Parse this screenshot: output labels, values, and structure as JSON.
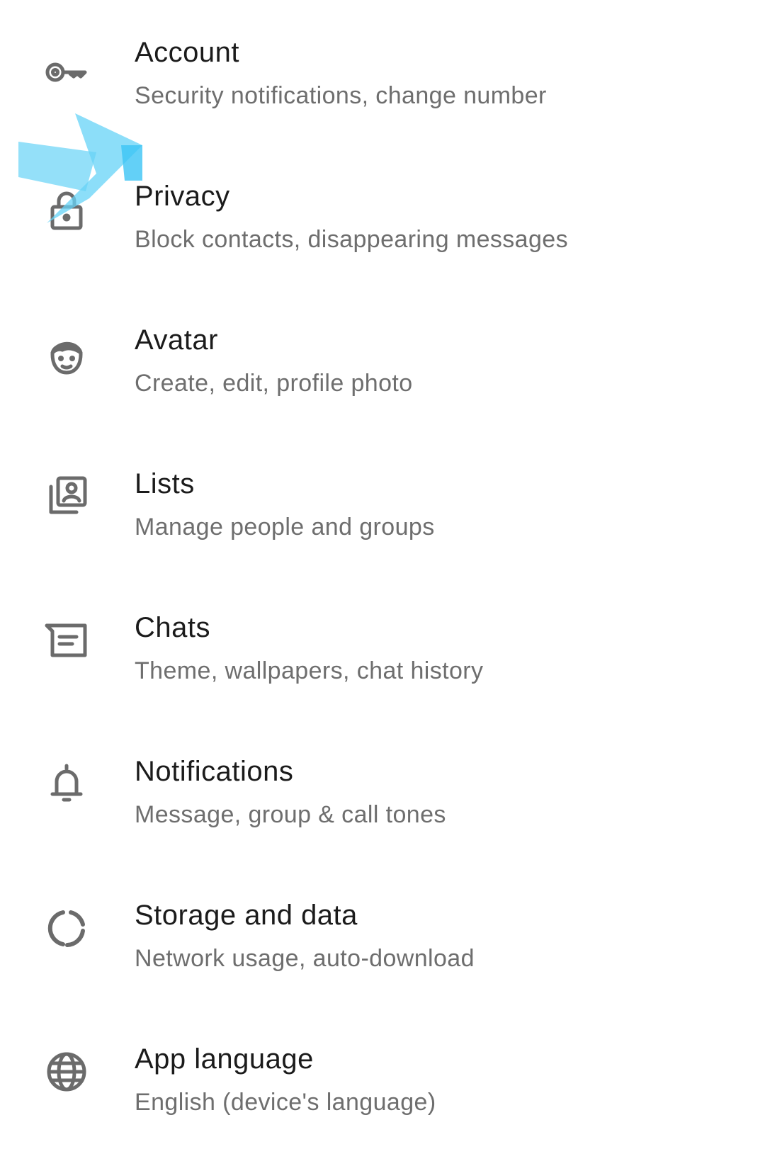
{
  "settings": {
    "items": [
      {
        "icon": "key-icon",
        "title": "Account",
        "subtitle": "Security notifications, change number"
      },
      {
        "icon": "lock-icon",
        "title": "Privacy",
        "subtitle": "Block contacts, disappearing messages"
      },
      {
        "icon": "avatar-face-icon",
        "title": "Avatar",
        "subtitle": "Create, edit, profile photo"
      },
      {
        "icon": "contact-list-icon",
        "title": "Lists",
        "subtitle": "Manage people and groups"
      },
      {
        "icon": "chat-icon",
        "title": "Chats",
        "subtitle": "Theme, wallpapers, chat history"
      },
      {
        "icon": "bell-icon",
        "title": "Notifications",
        "subtitle": "Message, group & call tones"
      },
      {
        "icon": "storage-ring-icon",
        "title": "Storage and data",
        "subtitle": "Network usage, auto-download"
      },
      {
        "icon": "globe-icon",
        "title": "App language",
        "subtitle": "English (device's language)"
      }
    ]
  },
  "colors": {
    "title": "#1b1b1b",
    "subtitle": "#6e6e6e",
    "icon": "#6b6b6b",
    "overlay": "#66d3f7"
  }
}
